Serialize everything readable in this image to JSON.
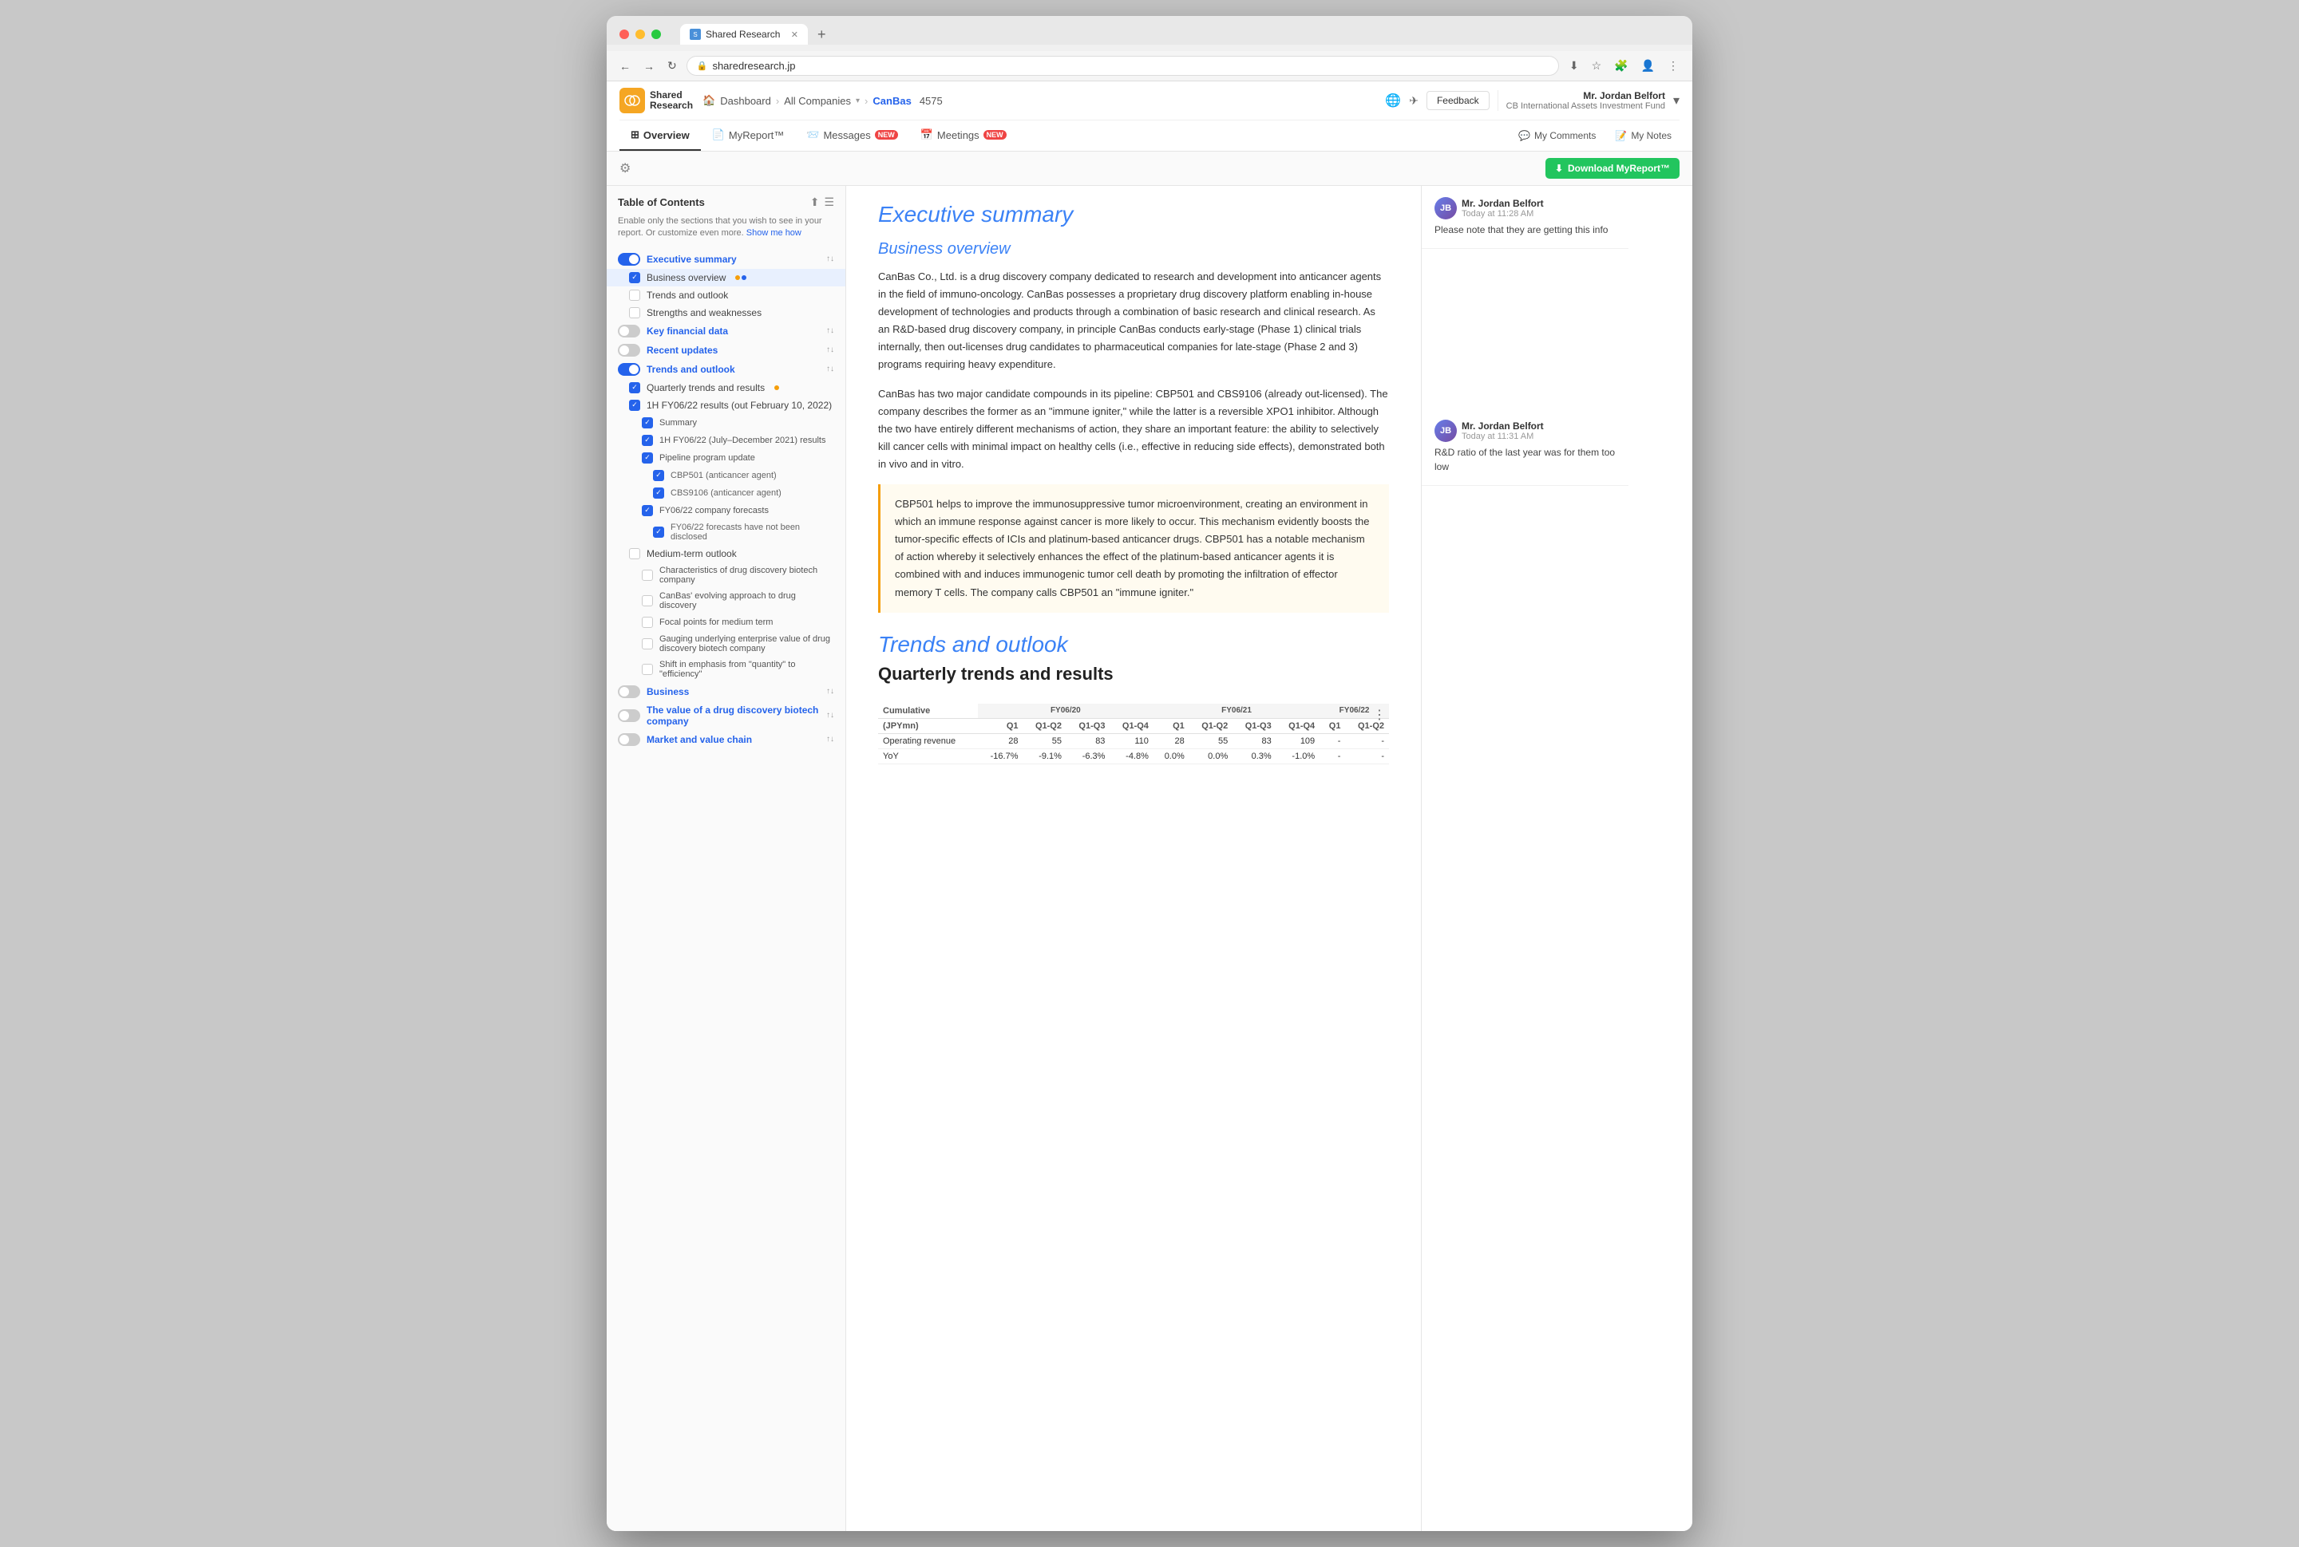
{
  "browser": {
    "tab_title": "Shared Research",
    "address": "sharedresearch.jp",
    "new_tab_icon": "+",
    "back_icon": "←",
    "forward_icon": "→",
    "refresh_icon": "↻"
  },
  "app": {
    "logo_text": "Shared\nResearch",
    "logo_initial": "SR",
    "breadcrumb": {
      "dashboard": "Dashboard",
      "all_companies": "All Companies",
      "company": "CanBas",
      "code": "4575"
    },
    "header_actions": {
      "globe_icon": "🌐",
      "send_icon": "✈",
      "feedback_label": "Feedback"
    },
    "user": {
      "name": "Mr. Jordan Belfort",
      "org": "CB International Assets Investment Fund",
      "chevron": "▾"
    },
    "nav": {
      "items": [
        {
          "label": "Overview",
          "id": "overview",
          "active": true
        },
        {
          "label": "MyReport™",
          "id": "myreport",
          "icon": "📄"
        },
        {
          "label": "Messages",
          "id": "messages",
          "badge": "NEW"
        },
        {
          "label": "Meetings",
          "id": "meetings",
          "badge": "NEW"
        }
      ],
      "right": {
        "comments_label": "My Comments",
        "notes_label": "My Notes"
      }
    }
  },
  "toolbar": {
    "gear_icon": "⚙",
    "download_label": "Download MyReport™"
  },
  "toc": {
    "title": "Table of Contents",
    "hint": "Enable only the sections that you wish to see in your report. Or customize even more.",
    "hint_link": "Show me how",
    "collapse_icon": "⬆",
    "list_icon": "☰",
    "items": [
      {
        "id": "executive-summary",
        "label": "Executive summary",
        "level": 1,
        "toggle": "on",
        "arrows": true
      },
      {
        "id": "business-overview",
        "label": "Business overview",
        "level": 2,
        "checked": true,
        "dots": [
          "orange",
          "blue"
        ]
      },
      {
        "id": "trends-outlook",
        "label": "Trends and outlook",
        "level": 2,
        "checked": false
      },
      {
        "id": "strengths-weaknesses",
        "label": "Strengths and weaknesses",
        "level": 2,
        "checked": false
      },
      {
        "id": "key-financial",
        "label": "Key financial data",
        "level": 1,
        "toggle": "off",
        "arrows": true
      },
      {
        "id": "recent-updates",
        "label": "Recent updates",
        "level": 1,
        "toggle": "off",
        "arrows": true
      },
      {
        "id": "trends-and-outlook-main",
        "label": "Trends and outlook",
        "level": 1,
        "toggle": "on",
        "arrows": true
      },
      {
        "id": "quarterly-trends",
        "label": "Quarterly trends and results",
        "level": 2,
        "checked": true,
        "dot": "orange"
      },
      {
        "id": "1h-results",
        "label": "1H FY06/22 results (out February 10, 2022)",
        "level": 2,
        "checked": true
      },
      {
        "id": "summary",
        "label": "Summary",
        "level": 3,
        "checked": true
      },
      {
        "id": "1h-2021",
        "label": "1H FY06/22 (July–December 2021) results",
        "level": 3,
        "checked": true
      },
      {
        "id": "pipeline-update",
        "label": "Pipeline program update",
        "level": 3,
        "checked": true
      },
      {
        "id": "cbp501",
        "label": "CBP501 (anticancer agent)",
        "level": 4,
        "checked": true
      },
      {
        "id": "cbs9106",
        "label": "CBS9106 (anticancer agent)",
        "level": 4,
        "checked": true
      },
      {
        "id": "fy0622-forecasts",
        "label": "FY06/22 company forecasts",
        "level": 3,
        "checked": true
      },
      {
        "id": "forecasts-not-disclosed",
        "label": "FY06/22 forecasts have not been disclosed",
        "level": 4,
        "checked": true
      },
      {
        "id": "medium-term",
        "label": "Medium-term outlook",
        "level": 2,
        "checked": false
      },
      {
        "id": "characteristics",
        "label": "Characteristics of drug discovery biotech company",
        "level": 3,
        "checked": false
      },
      {
        "id": "canbas-evolving",
        "label": "CanBas' evolving approach to drug discovery",
        "level": 3,
        "checked": false
      },
      {
        "id": "focal-points",
        "label": "Focal points for medium term",
        "level": 3,
        "checked": false
      },
      {
        "id": "gauging",
        "label": "Gauging underlying enterprise value of drug discovery biotech company",
        "level": 3,
        "checked": false
      },
      {
        "id": "shift-emphasis",
        "label": "Shift in emphasis from \"quantity\" to \"efficiency\"",
        "level": 3,
        "checked": false
      },
      {
        "id": "business",
        "label": "Business",
        "level": 1,
        "toggle": "off",
        "arrows": true
      },
      {
        "id": "value-biotech",
        "label": "The value of a drug discovery biotech company",
        "level": 1,
        "toggle": "off",
        "arrows": true
      },
      {
        "id": "market-value",
        "label": "Market and value chain",
        "level": 1,
        "toggle": "off",
        "arrows": true
      }
    ]
  },
  "content": {
    "section1_title": "Executive summary",
    "section1_sub": "Business overview",
    "para1": "CanBas Co., Ltd. is a drug discovery company dedicated to research and development into anticancer agents in the field of immuno-oncology. CanBas possesses a proprietary drug discovery platform enabling in-house development of technologies and products through a combination of basic research and clinical research. As an R&D-based drug discovery company, in principle CanBas conducts early-stage (Phase 1) clinical trials internally, then out-licenses drug candidates to pharmaceutical companies for late-stage (Phase 2 and 3) programs requiring heavy expenditure.",
    "para2": "CanBas has two major candidate compounds in its pipeline: CBP501 and CBS9106 (already out-licensed). The company describes the former as an \"immune igniter,\" while the latter is a reversible XPO1 inhibitor. Although the two have entirely different mechanisms of action, they share an important feature: the ability to selectively kill cancer cells with minimal impact on healthy cells (i.e., effective in reducing side effects), demonstrated both in vivo and in vitro.",
    "highlighted": "CBP501 helps to improve the immunosuppressive tumor microenvironment, creating an environment in which an immune response against cancer is more likely to occur. This mechanism evidently boosts the tumor-specific effects of ICIs and platinum-based anticancer drugs. CBP501 has a notable mechanism of action whereby it selectively enhances the effect of the platinum-based anticancer agents it is combined with and induces immunogenic tumor cell death by promoting the infiltration of effector memory T cells. The company calls CBP501 an \"immune igniter.\"",
    "section2_title": "Trends and outlook",
    "section2_sub": "Quarterly trends and results",
    "table": {
      "label_col": "(JPYmn)",
      "headers": [
        "Q1",
        "Q1-Q2",
        "Q1-Q3",
        "Q1-Q4",
        "Q1",
        "Q1-Q2",
        "Q1-Q3",
        "Q1-Q4",
        "Q1",
        "Q1-Q2"
      ],
      "group_headers": [
        "FY06/20",
        "",
        "",
        "",
        "FY06/21",
        "",
        "",
        "",
        "FY06/22",
        ""
      ],
      "rows": [
        {
          "label": "Operating revenue",
          "values": [
            "28",
            "55",
            "83",
            "110",
            "28",
            "55",
            "83",
            "109",
            "-",
            "-"
          ]
        },
        {
          "label": "YoY",
          "values": [
            "-16.7%",
            "-9.1%",
            "-6.3%",
            "-4.8%",
            "0.0%",
            "0.0%",
            "0.3%",
            "-1.0%",
            "-",
            "-"
          ]
        }
      ]
    }
  },
  "comments": [
    {
      "id": "comment1",
      "user": "Mr. Jordan Belfort",
      "time": "Today at 11:28 AM",
      "text": "Please note that they are getting this info",
      "initials": "JB"
    },
    {
      "id": "comment2",
      "user": "Mr. Jordan Belfort",
      "time": "Today at 11:31 AM",
      "text": "R&D ratio of the last year was for them too low",
      "initials": "JB"
    }
  ]
}
